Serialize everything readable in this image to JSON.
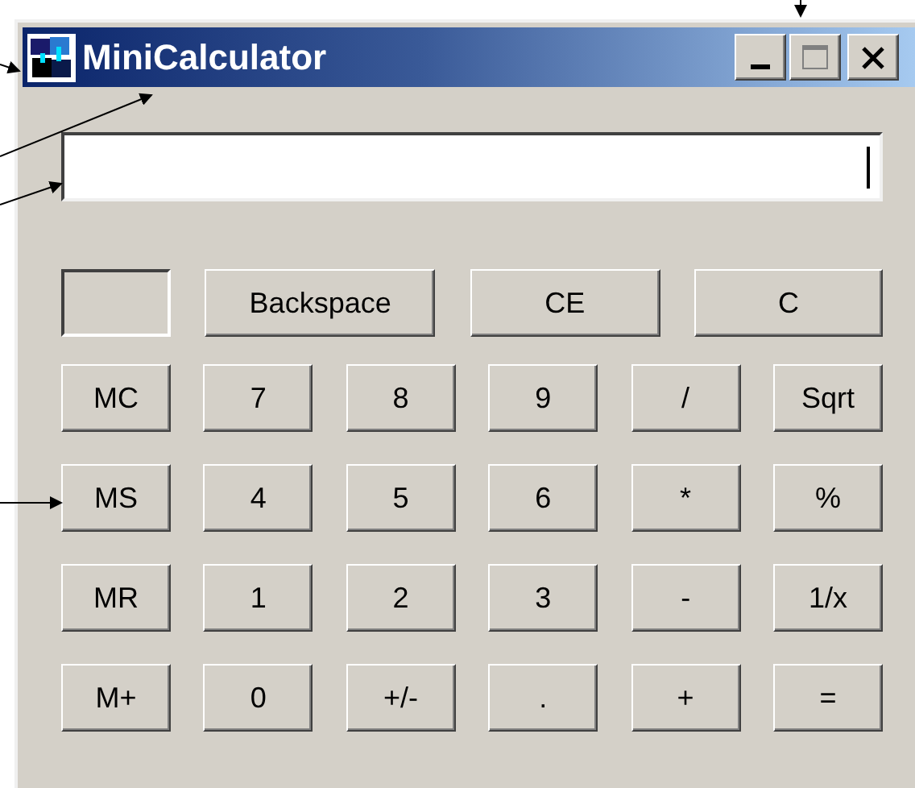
{
  "window": {
    "title": "MiniCalculator"
  },
  "top_row": [
    {
      "kind": "indicator"
    },
    {
      "kind": "button",
      "label": "Backspace"
    },
    {
      "kind": "button",
      "label": "CE"
    },
    {
      "kind": "button",
      "label": "C"
    }
  ],
  "keypad": [
    [
      "MC",
      "7",
      "8",
      "9",
      "/",
      "Sqrt"
    ],
    [
      "MS",
      "4",
      "5",
      "6",
      "*",
      "%"
    ],
    [
      "MR",
      "1",
      "2",
      "3",
      "-",
      "1/x"
    ],
    [
      "M+",
      "0",
      "+/-",
      ".",
      "+",
      "="
    ]
  ]
}
